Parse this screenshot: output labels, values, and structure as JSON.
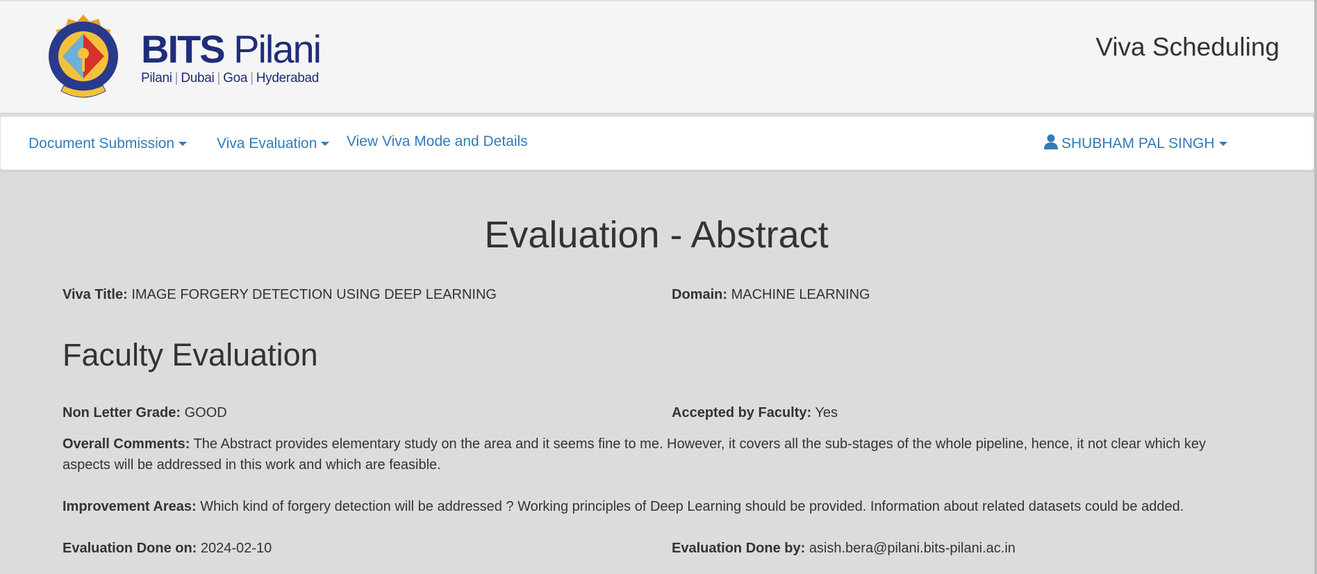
{
  "header": {
    "logo": {
      "name_bold": "BITS",
      "name_regular": "Pilani",
      "campuses": [
        "Pilani",
        "Dubai",
        "Goa",
        "Hyderabad"
      ],
      "emblem_icon": "bits-emblem-icon"
    },
    "app_title": "Viva Scheduling"
  },
  "nav": {
    "items": [
      {
        "label": "Document Submission",
        "dropdown": true
      },
      {
        "label": "Viva Evaluation",
        "dropdown": true
      },
      {
        "label": "View Viva Mode and Details",
        "dropdown": false
      }
    ],
    "user": {
      "name": "SHUBHAM PAL SINGH",
      "icon": "user-icon",
      "dropdown": true
    },
    "link_color": "#337ab7"
  },
  "main": {
    "heading": "Evaluation - Abstract",
    "viva_title": {
      "label": "Viva Title:",
      "value": "IMAGE FORGERY DETECTION USING DEEP LEARNING"
    },
    "domain": {
      "label": "Domain:",
      "value": "MACHINE LEARNING"
    },
    "section_heading": "Faculty Evaluation",
    "grade": {
      "label": "Non Letter Grade:",
      "value": "GOOD"
    },
    "accepted": {
      "label": "Accepted by Faculty:",
      "value": "Yes"
    },
    "overall_comments": {
      "label": "Overall Comments:",
      "value": "The Abstract provides elementary study on the area and it seems fine to me. However, it covers all the sub-stages of the whole pipeline, hence, it not clear which key aspects will be addressed in this work and which are feasible."
    },
    "improvement_areas": {
      "label": "Improvement Areas:",
      "value": "Which kind of forgery detection will be addressed ? Working principles of Deep Learning should be provided. Information about related datasets could be added."
    },
    "evaluation_date": {
      "label": "Evaluation Done on:",
      "value": "2024-02-10"
    },
    "evaluated_by": {
      "label": "Evaluation Done by:",
      "value": "asish.bera@pilani.bits-pilani.ac.in"
    }
  }
}
